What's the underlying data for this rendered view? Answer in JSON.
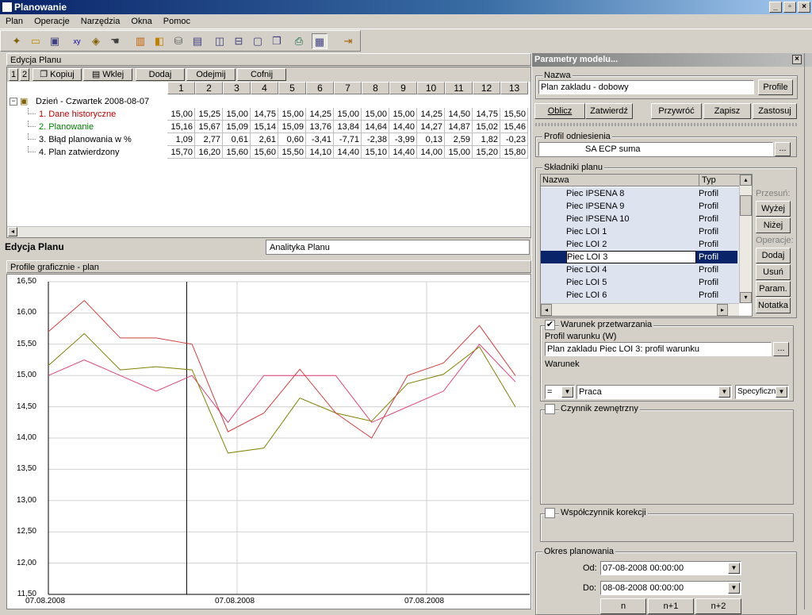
{
  "window": {
    "title": "Planowanie"
  },
  "menu": [
    "Plan",
    "Operacje",
    "Narzędzia",
    "Okna",
    "Pomoc"
  ],
  "edit_panel": {
    "title": "Edycja Planu",
    "tabs_num": [
      "1",
      "2"
    ],
    "buttons": {
      "kopiuj": "Kopiuj",
      "wklej": "Wklej",
      "dodaj": "Dodaj",
      "odejmij": "Odejmij",
      "cofnij": "Cofnij"
    },
    "columns": [
      "1",
      "2",
      "3",
      "4",
      "5",
      "6",
      "7",
      "8",
      "9",
      "10",
      "11",
      "12",
      "13"
    ],
    "tree_root": "Dzień - Czwartek 2008-08-07",
    "rows": [
      {
        "label": "1. Dane historyczne",
        "color": "#c00000",
        "values": [
          "15,00",
          "15,25",
          "15,00",
          "14,75",
          "15,00",
          "14,25",
          "15,00",
          "15,00",
          "15,00",
          "14,25",
          "14,50",
          "14,75",
          "15,50"
        ]
      },
      {
        "label": "2. Planowanie",
        "color": "#008000",
        "values": [
          "15,16",
          "15,67",
          "15,09",
          "15,14",
          "15,09",
          "13,76",
          "13,84",
          "14,64",
          "14,40",
          "14,27",
          "14,87",
          "15,02",
          "15,46"
        ]
      },
      {
        "label": "3. Błąd planowania w %",
        "color": "#000000",
        "values": [
          "1,09",
          "2,77",
          "0,61",
          "2,61",
          "0,60",
          "-3,41",
          "-7,71",
          "-2,38",
          "-3,99",
          "0,13",
          "2,59",
          "1,82",
          "-0,23"
        ]
      },
      {
        "label": "4. Plan zatwierdzony",
        "color": "#000000",
        "values": [
          "15,70",
          "16,20",
          "15,60",
          "15,60",
          "15,50",
          "14,10",
          "14,40",
          "15,10",
          "14,40",
          "14,00",
          "15,00",
          "15,20",
          "15,80"
        ]
      }
    ],
    "right_edge_digits": [
      "5",
      "5",
      "3"
    ]
  },
  "bottom_tabs": {
    "edit": "Edycja Planu",
    "analytics": "Analityka Planu"
  },
  "chart_panel": {
    "title": "Profile graficznie - plan"
  },
  "chart_data": {
    "type": "line",
    "x": [
      1,
      2,
      3,
      4,
      5,
      6,
      7,
      8,
      9,
      10,
      11,
      12,
      13,
      14
    ],
    "ylim": [
      11.5,
      16.5
    ],
    "yticks": [
      "16,50",
      "16,00",
      "15,50",
      "15,00",
      "14,50",
      "14,00",
      "13,50",
      "13,00",
      "12,50",
      "12,00",
      "11,50"
    ],
    "xtick_labels": [
      "07.08.2008",
      "07.08.2008",
      "07.08.2008"
    ],
    "cursor_x": 4.85,
    "grid": true,
    "series": [
      {
        "color": "#e0407a",
        "values": [
          15.0,
          15.25,
          15.0,
          14.75,
          15.0,
          14.25,
          15.0,
          15.0,
          15.0,
          14.25,
          14.5,
          14.75,
          15.5,
          14.9
        ]
      },
      {
        "color": "#808000",
        "values": [
          15.16,
          15.67,
          15.09,
          15.14,
          15.09,
          13.76,
          13.84,
          14.64,
          14.4,
          14.27,
          14.87,
          15.02,
          15.46,
          14.5
        ]
      },
      {
        "color": "#d04040",
        "values": [
          15.7,
          16.2,
          15.6,
          15.6,
          15.5,
          14.1,
          14.4,
          15.1,
          14.4,
          14.0,
          15.0,
          15.2,
          15.8,
          15.0
        ]
      }
    ]
  },
  "model_params": {
    "title": "Parametry modelu...",
    "name_group": "Nazwa",
    "name_value": "Plan zakladu - dobowy",
    "profile_btn": "Profile",
    "btn_oblicz": "Oblicz",
    "btn_zatwierdz": "Zatwierdź",
    "btn_przywroc": "Przywróć",
    "btn_zapisz": "Zapisz",
    "btn_zastosuj": "Zastosuj",
    "ref_group": "Profil odniesienia",
    "ref_value": "SA ECP suma",
    "browse": "...",
    "components_group": "Składniki planu",
    "col_name": "Nazwa",
    "col_type": "Typ",
    "items": [
      {
        "name": "Piec IPSENA 8",
        "type": "Profil"
      },
      {
        "name": "Piec IPSENA 9",
        "type": "Profil"
      },
      {
        "name": "Piec IPSENA 10",
        "type": "Profil"
      },
      {
        "name": "Piec LOI 1",
        "type": "Profil"
      },
      {
        "name": "Piec LOI 2",
        "type": "Profil"
      },
      {
        "name": "Piec LOI 3",
        "type": "Profil"
      },
      {
        "name": "Piec LOI 4",
        "type": "Profil"
      },
      {
        "name": "Piec LOI 5",
        "type": "Profil"
      },
      {
        "name": "Piec LOI 6",
        "type": "Profil"
      }
    ],
    "selected_index": 5,
    "move_label": "Przesuń:",
    "btn_wyzej": "Wyżej",
    "btn_nizej": "Niżej",
    "ops_label": "Operacje:",
    "btn_dodaj": "Dodaj",
    "btn_usun": "Usuń",
    "btn_param": "Param.",
    "btn_notatka": "Notatka",
    "cond_check": "Warunek przetwarzania",
    "cond_profile_label": "Profil warunku (W)",
    "cond_profile_value": "Plan zakladu Piec LOI 3: profil warunku",
    "cond_label": "Warunek",
    "cond_op": "=",
    "cond_value": "Praca",
    "cond_spec": "Specyficzna",
    "external_check": "Czynnik zewnętrzny",
    "correction_check": "Współczynnik korekcji",
    "period_group": "Okres planowania",
    "from_label": "Od:",
    "from_value": "07-08-2008 00:00:00",
    "to_label": "Do:",
    "to_value": "08-08-2008 00:00:00",
    "btn_n": "n",
    "btn_n1": "n+1",
    "btn_n2": "n+2"
  }
}
